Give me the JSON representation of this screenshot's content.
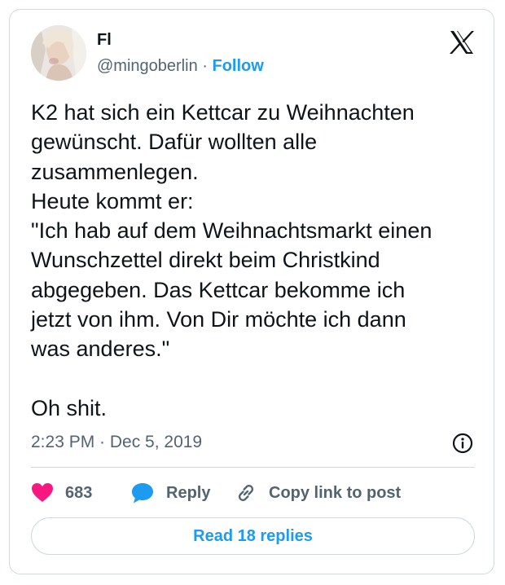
{
  "author": {
    "display_name": "Fl",
    "handle": "@mingoberlin",
    "separator": "·",
    "follow_label": "Follow",
    "avatar_icon": "profile-photo-avatar"
  },
  "brand": {
    "logo_icon": "x-logo-icon"
  },
  "tweet": {
    "text": "K2 hat sich ein Kettcar zu Weihnachten\ngewünscht. Dafür wollten alle\nzusammenlegen.\nHeute kommt er:\n\"Ich hab auf dem Weihnachtsmarkt einen\nWunschzettel direkt beim Christkind\nabgegeben. Das Kettcar bekomme ich\njetzt von ihm. Von Dir möchte ich dann\nwas anderes.\"\n\nOh shit.",
    "timestamp": "2:23 PM · Dec 5, 2019"
  },
  "actions": {
    "like_count": "683",
    "reply_label": "Reply",
    "copy_label": "Copy link to post",
    "read_replies_label": "Read 18 replies"
  },
  "colors": {
    "accent": "#1d9bf0",
    "like": "#f91880",
    "muted": "#536471",
    "text": "#0f1419",
    "border": "#cfd9de"
  }
}
